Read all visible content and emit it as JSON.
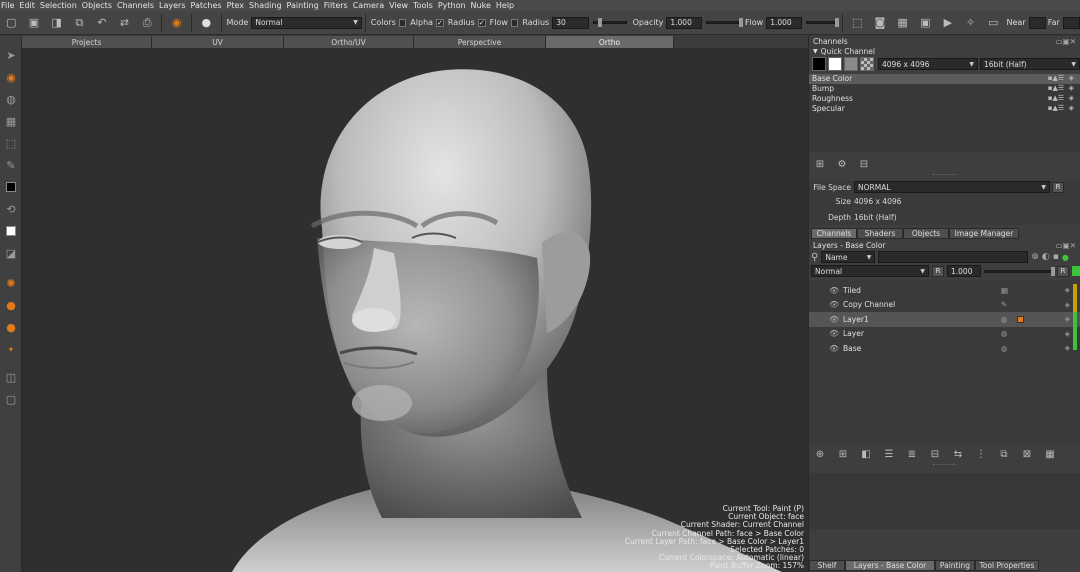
{
  "menu": [
    "File",
    "Edit",
    "Selection",
    "Objects",
    "Channels",
    "Layers",
    "Patches",
    "Ptex",
    "Shading",
    "Painting",
    "Filters",
    "Camera",
    "View",
    "Tools",
    "Python",
    "Nuke",
    "Help"
  ],
  "toolbar": {
    "mode_label": "Mode",
    "mode_value": "Normal",
    "colors_label": "Colors",
    "alpha_label": "Alpha",
    "radius_label": "Radius",
    "flow_check_label": "Flow",
    "radius2_label": "Radius",
    "radius_value": "30",
    "opacity_label": "Opacity",
    "opacity_value": "1.000",
    "flow_label": "Flow",
    "flow_value": "1.000",
    "near_label": "Near",
    "far_label": "Far"
  },
  "viewport_tabs": [
    "Projects",
    "UV",
    "Ortho/UV",
    "Perspective",
    "Ortho"
  ],
  "active_viewport_tab": "Ortho",
  "hud": [
    "Current Tool: Paint (P)",
    "Current Object: face",
    "Current Shader: Current Channel",
    "Current Channel Path: face > Base Color",
    "Current Layer Path: face > Base Color > Layer1",
    "Selected Patches: 0",
    "Current Colorspace: Automatic (linear)",
    "Paint Buffer Zoom: 157%"
  ],
  "channels_panel": {
    "title": "Channels",
    "quick_channel": "Quick Channel",
    "size_value": "4096 x 4096",
    "depth_value": "16bit (Half)",
    "channels": [
      "Base Color",
      "Bump",
      "Roughness",
      "Specular"
    ],
    "selected_channel": "Base Color",
    "props": {
      "file_space_label": "File Space",
      "file_space_value": "NORMAL",
      "size_label": "Size",
      "size_value": "4096 x 4096",
      "depth_label": "Depth",
      "depth_value": "16bit (Half)"
    }
  },
  "panel_tabs": [
    "Channels",
    "Shaders",
    "Objects",
    "Image Manager"
  ],
  "layers_panel": {
    "title": "Layers - Base Color",
    "filter_value": "Name",
    "blend_mode": "Normal",
    "opacity": "1.000",
    "layers": [
      "Tiled",
      "Copy Channel",
      "Layer1",
      "Layer",
      "Base"
    ],
    "selected_layer": "Layer1"
  },
  "bottom_tabs": [
    "Shelf",
    "Layers - Base Color",
    "Painting",
    "Tool Properties"
  ],
  "active_bottom_tab": "Layers - Base Color",
  "colors": {
    "accent_orange": "#e07a1a",
    "layer_green": "#3cc43c",
    "layer_yellow": "#c8a000"
  }
}
